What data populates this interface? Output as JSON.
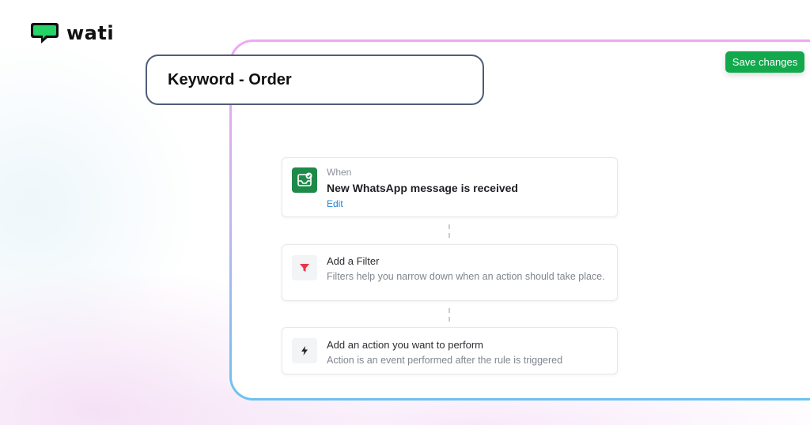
{
  "brand": {
    "name": "wati",
    "accent": "#11a94c"
  },
  "toolbar": {
    "save_label": "Save changes"
  },
  "rule": {
    "title": "Keyword - Order"
  },
  "trigger": {
    "caption": "When",
    "title": "New WhatsApp message is received",
    "edit_label": "Edit",
    "icon": "inbox-check-icon"
  },
  "filter": {
    "title": "Add a Filter",
    "description": "Filters help you narrow down when an action should take place.",
    "icon": "funnel-icon"
  },
  "action": {
    "title": "Add an action you want to perform",
    "description": "Action is an event performed after the rule is triggered",
    "icon": "lightning-icon"
  }
}
